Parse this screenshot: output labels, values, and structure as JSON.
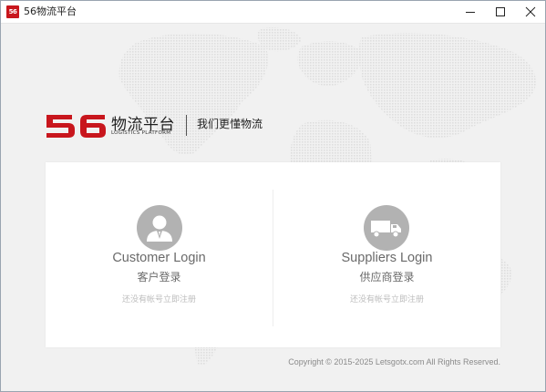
{
  "window": {
    "title": "56物流平台",
    "icon_text": "56",
    "controls": [
      "minimize-icon",
      "maximize-icon",
      "close-icon"
    ]
  },
  "brand": {
    "logo_number": "56",
    "name_cn": "物流平台",
    "name_en": "LOGISTICS PLATFORM",
    "slogan": "我们更懂物流",
    "colors": {
      "brand_red": "#c8161d"
    }
  },
  "login": {
    "customer": {
      "title": "Customer Login",
      "subtitle": "客户登录",
      "register": "还没有帐号立即注册",
      "icon": "user-avatar-icon"
    },
    "supplier": {
      "title": "Suppliers Login",
      "subtitle": "供应商登录",
      "register": "还没有帐号立即注册",
      "icon": "truck-icon"
    }
  },
  "footer": {
    "copyright": "Copyright © 2015-2025 Letsgotx.com All Rights Reserved."
  }
}
